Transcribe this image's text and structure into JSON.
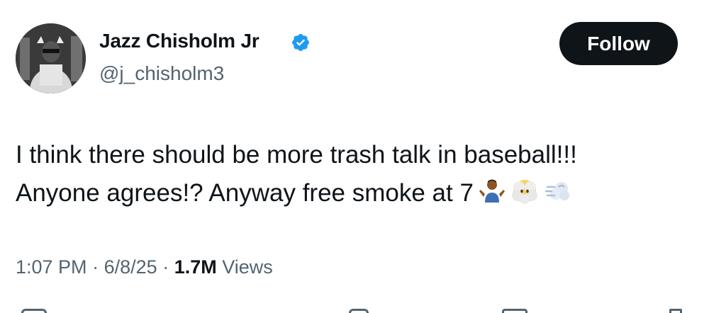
{
  "author": {
    "display_name": "Jazz Chisholm Jr",
    "handle": "@j_chisholm3",
    "verified": true,
    "avatar_icon": "profile-photo"
  },
  "follow_button": {
    "label": "Follow"
  },
  "tweet": {
    "lines": [
      "I think there should be more trash talk in baseball!!!",
      "Anyone agrees!? Anyway free smoke at 7"
    ],
    "emojis": [
      "person-shrugging-emoji",
      "face-in-clouds-emoji",
      "dashing-away-emoji"
    ]
  },
  "meta": {
    "time": "1:07 PM",
    "date": "6/8/25",
    "separator": "·",
    "views_count": "1.7M",
    "views_label": "Views"
  },
  "colors": {
    "text_primary": "#0f1419",
    "text_secondary": "#536471",
    "verified_blue": "#1d9bf0",
    "button_bg": "#0f1419",
    "background": "#ffffff"
  }
}
